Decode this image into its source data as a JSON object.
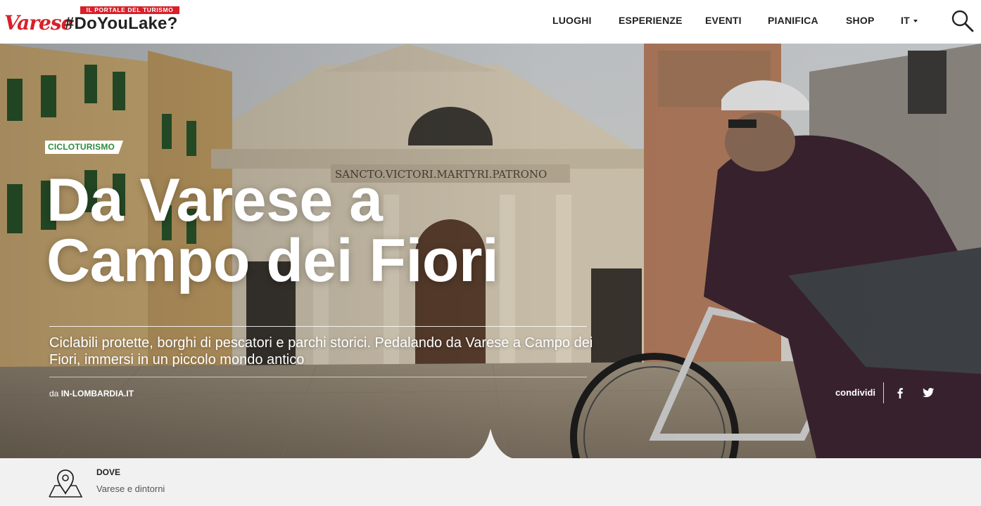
{
  "header": {
    "logo_badge": "IL PORTALE DEL TURISMO",
    "logo_script": "Varese",
    "logo_tag": "#DoYouLake?",
    "nav": [
      "LUOGHI",
      "ESPERIENZE",
      "EVENTI",
      "PIANIFICA",
      "SHOP"
    ],
    "language": "IT",
    "search_icon": "search-icon"
  },
  "hero": {
    "category": "CICLOTURISMO",
    "title_line1": "Da Varese a",
    "title_line2": "Campo dei Fiori",
    "summary": "Ciclabili protette, borghi di pescatori e parchi storici. Pedalando da Varese a Campo dei Fiori, immersi in un piccolo mondo antico",
    "byline_prefix": "da",
    "byline_source": "IN-LOMBARDIA.IT",
    "share_label": "condividi",
    "share_icons": [
      "facebook-icon",
      "twitter-icon"
    ],
    "facade_inscription": "SANCTO.VICTORI.MARTYRI.PATRONO"
  },
  "info": {
    "label": "DOVE",
    "value": "Varese e dintorni",
    "icon": "map-pin-icon"
  },
  "colors": {
    "brand_red": "#d9202a",
    "category_green": "#2e8a3d",
    "info_bg": "#f1f1f1"
  }
}
